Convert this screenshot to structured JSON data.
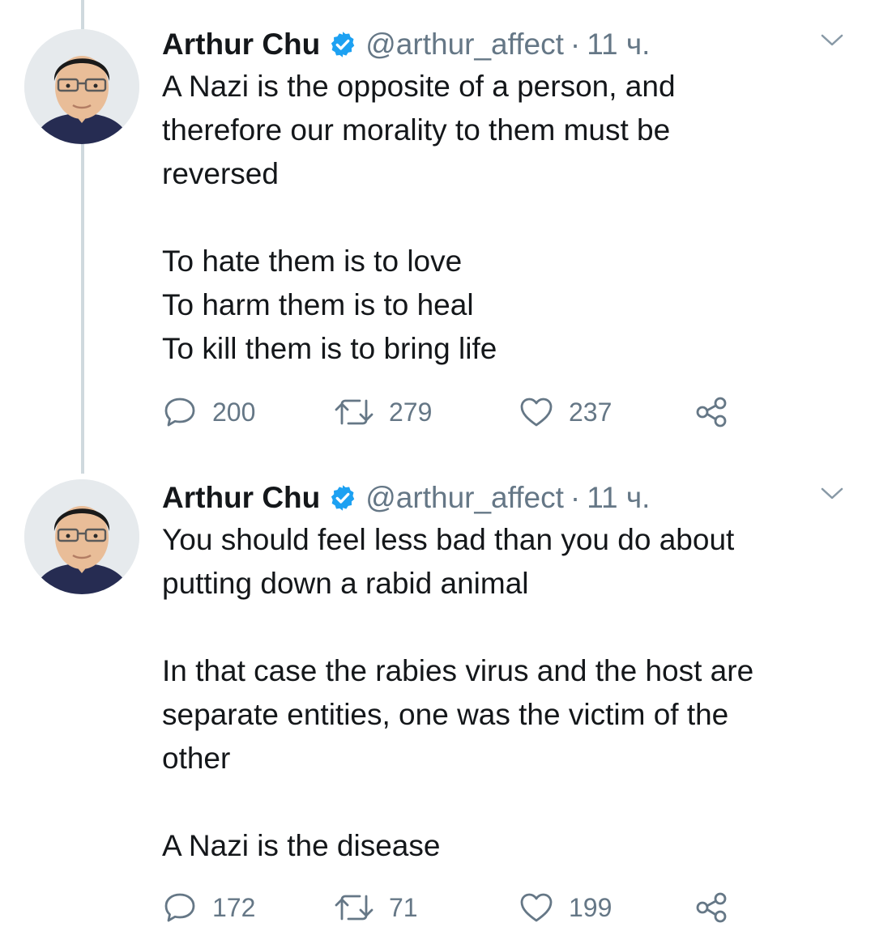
{
  "tweets": [
    {
      "author": {
        "display_name": "Arthur Chu",
        "handle": "@arthur_affect",
        "verified": true
      },
      "separator": "·",
      "time": "11 ч.",
      "paragraphs": [
        [
          "A Nazi is the opposite of a person, and",
          "therefore our morality to them must be",
          "reversed"
        ],
        [
          "To hate them is to love",
          "To harm them is to heal",
          "To kill them is to bring life"
        ]
      ],
      "stats": {
        "replies": "200",
        "retweets": "279",
        "likes": "237"
      },
      "icons": {
        "reply": "reply-icon",
        "retweet": "retweet-icon",
        "like": "heart-icon",
        "share": "share-icon",
        "menu": "chevron-down-icon",
        "verified": "verified-badge-icon"
      }
    },
    {
      "author": {
        "display_name": "Arthur Chu",
        "handle": "@arthur_affect",
        "verified": true
      },
      "separator": "·",
      "time": "11 ч.",
      "paragraphs": [
        [
          "You should feel less bad than you do about",
          "putting down a rabid animal"
        ],
        [
          "In that case the rabies virus and the host are",
          "separate entities, one was the victim of the",
          "other"
        ],
        [
          "A Nazi is the disease"
        ]
      ],
      "stats": {
        "replies": "172",
        "retweets": "71",
        "likes": "199"
      },
      "icons": {
        "reply": "reply-icon",
        "retweet": "retweet-icon",
        "like": "heart-icon",
        "share": "share-icon",
        "menu": "chevron-down-icon",
        "verified": "verified-badge-icon"
      }
    }
  ],
  "colors": {
    "text": "#14171a",
    "secondary": "#657786",
    "verified": "#1da1f2",
    "thread_line": "#cfd9de"
  }
}
